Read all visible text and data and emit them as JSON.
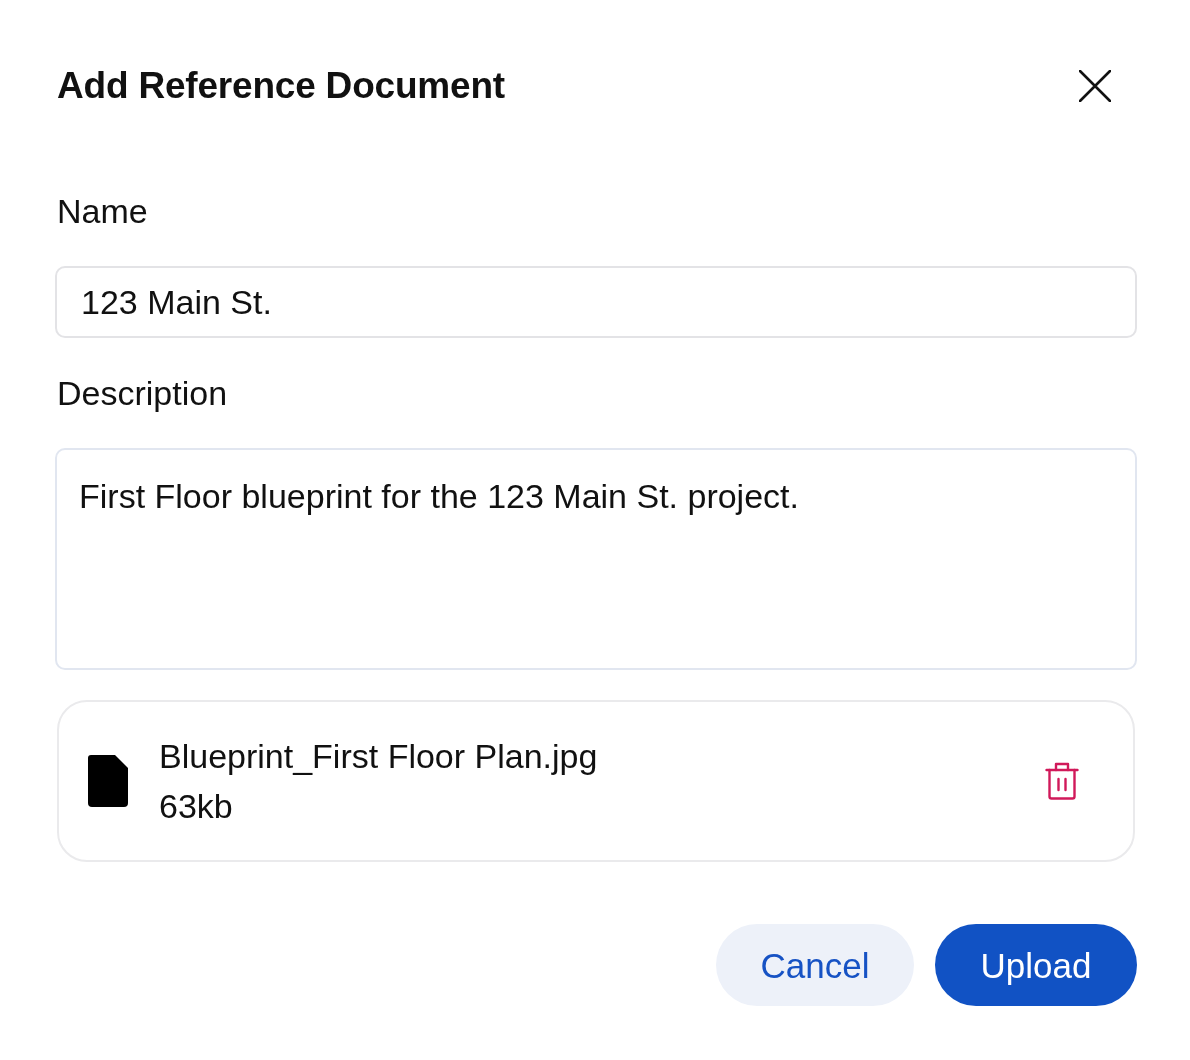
{
  "dialog": {
    "title": "Add Reference Document"
  },
  "fields": [
    {
      "label": "Name",
      "kind": "input",
      "value": "123 Main St."
    },
    {
      "label": "Description",
      "kind": "textarea",
      "value": "First Floor blueprint for the 123 Main St. project."
    }
  ],
  "attachment": {
    "file_name": "Blueprint_First Floor Plan.jpg",
    "size": "63kb"
  },
  "buttons": [
    {
      "label": "Cancel",
      "kind": "secondary"
    },
    {
      "label": "Upload",
      "kind": "primary"
    }
  ]
}
